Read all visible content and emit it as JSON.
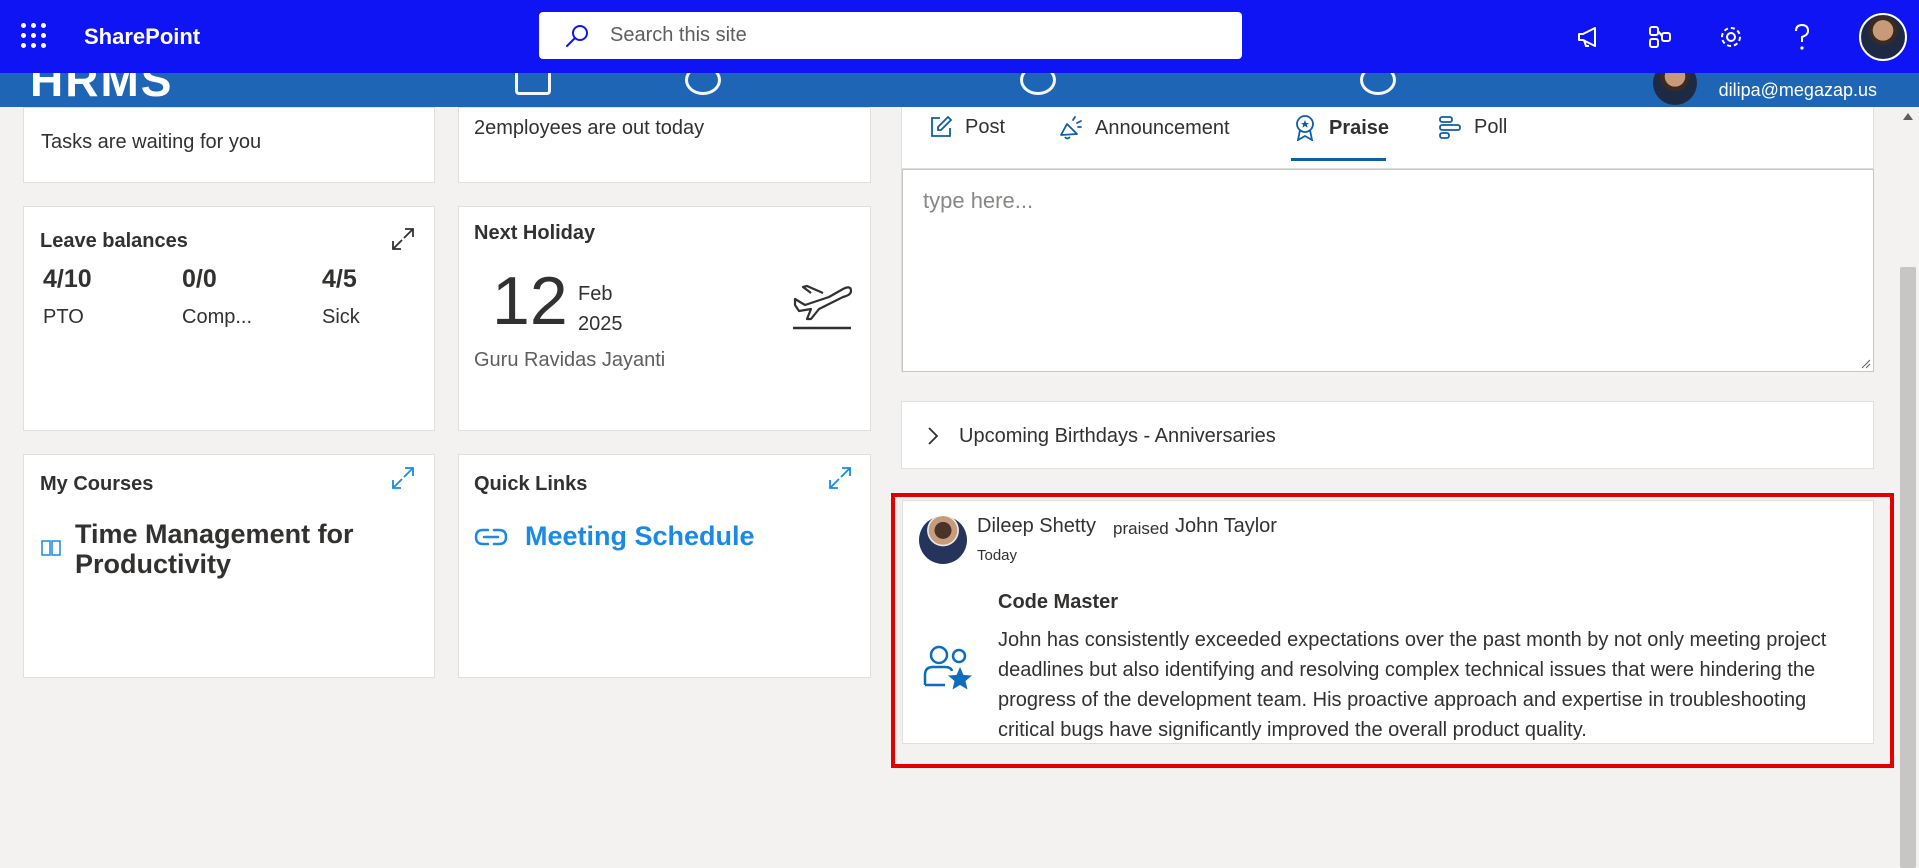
{
  "suitebar": {
    "app_name": "SharePoint",
    "search_placeholder": "Search this site",
    "icons": [
      "megaphone-icon",
      "share-network-icon",
      "gear-icon",
      "help-icon",
      "user-avatar"
    ]
  },
  "site_header": {
    "logo_text": "HRMS",
    "user_email": "dilipa@megazap.us"
  },
  "tasks_card": {
    "text": "Tasks are waiting for you"
  },
  "out_today_card": {
    "text": "2employees are out today"
  },
  "leave_balances": {
    "title": "Leave balances",
    "items": [
      {
        "value": "4/10",
        "label": "PTO"
      },
      {
        "value": "0/0",
        "label": "Comp..."
      },
      {
        "value": "4/5",
        "label": "Sick"
      }
    ]
  },
  "next_holiday": {
    "title": "Next Holiday",
    "day": "12",
    "month": "Feb",
    "year": "2025",
    "name": "Guru Ravidas Jayanti"
  },
  "my_courses": {
    "title": "My Courses",
    "course": "Time Management for Productivity"
  },
  "quick_links": {
    "title": "Quick Links",
    "link": "Meeting Schedule"
  },
  "composer": {
    "tabs": [
      {
        "label": "Post",
        "icon": "edit-icon"
      },
      {
        "label": "Announcement",
        "icon": "megaphone-icon"
      },
      {
        "label": "Praise",
        "icon": "award-ribbon-icon",
        "active": true
      },
      {
        "label": "Poll",
        "icon": "poll-icon"
      }
    ],
    "placeholder": "type here..."
  },
  "birthdays": {
    "label": "Upcoming Birthdays - Anniversaries"
  },
  "praise_post": {
    "from": "Dileep Shetty",
    "verb": "praised",
    "to": "John Taylor",
    "date": "Today",
    "badge_title": "Code Master",
    "message": "John has consistently exceeded expectations over the past month by not only meeting project deadlines but also identifying and resolving complex technical issues that were hindering the progress of the development team. His proactive approach and expertise in troubleshooting critical bugs have significantly improved the overall product quality."
  },
  "colors": {
    "suitebar": "#0f14f5",
    "site_header": "#1e66b5",
    "accent_link": "#1a8ae6",
    "highlight_border": "#e00000"
  }
}
